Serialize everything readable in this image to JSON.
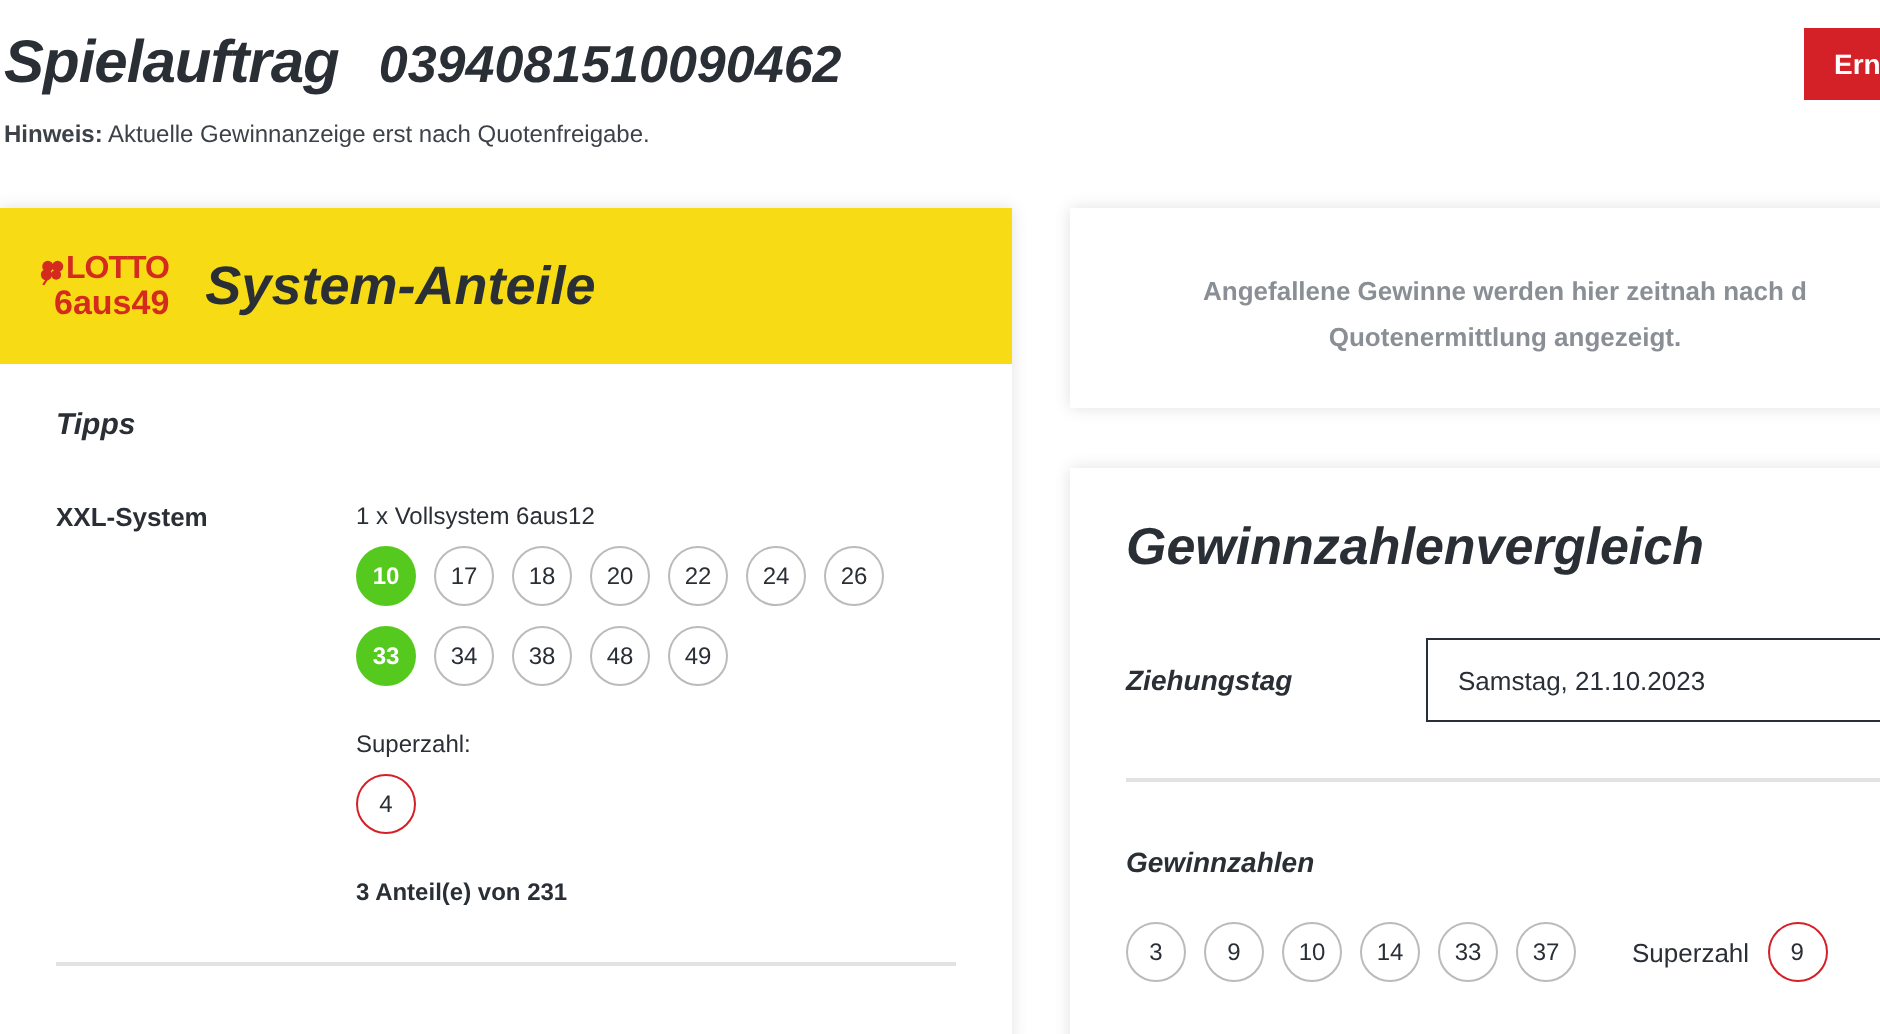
{
  "header": {
    "title": "Spielauftrag",
    "order_number": "0394081510090462",
    "button": "Ern",
    "note_label": "Hinweis:",
    "note": "Aktuelle Gewinnanzeige erst nach Quotenfreigabe."
  },
  "ticket": {
    "logo_top": "LOTTO",
    "logo_bottom": "6aus49",
    "title": "System-Anteile",
    "section": "Tipps",
    "tip_label": "XXL-System",
    "system": "1 x Vollsystem 6aus12",
    "numbers": [
      {
        "value": "10",
        "hit": true
      },
      {
        "value": "17",
        "hit": false
      },
      {
        "value": "18",
        "hit": false
      },
      {
        "value": "20",
        "hit": false
      },
      {
        "value": "22",
        "hit": false
      },
      {
        "value": "24",
        "hit": false
      },
      {
        "value": "26",
        "hit": false
      },
      {
        "value": "33",
        "hit": true
      },
      {
        "value": "34",
        "hit": false
      },
      {
        "value": "38",
        "hit": false
      },
      {
        "value": "48",
        "hit": false
      },
      {
        "value": "49",
        "hit": false
      }
    ],
    "superzahl_label": "Superzahl:",
    "superzahl": "4",
    "shares": "3 Anteil(e) von 231"
  },
  "notice": {
    "line1": "Angefallene Gewinne werden hier zeitnah nach d",
    "line2": "Quotenermittlung angezeigt."
  },
  "comparison": {
    "title": "Gewinnzahlenvergleich",
    "date_label": "Ziehungstag",
    "date_value": "Samstag, 21.10.2023",
    "numbers_label": "Gewinnzahlen",
    "winning_numbers": [
      "3",
      "9",
      "10",
      "14",
      "33",
      "37"
    ],
    "superzahl_label": "Superzahl",
    "superzahl": "9"
  }
}
